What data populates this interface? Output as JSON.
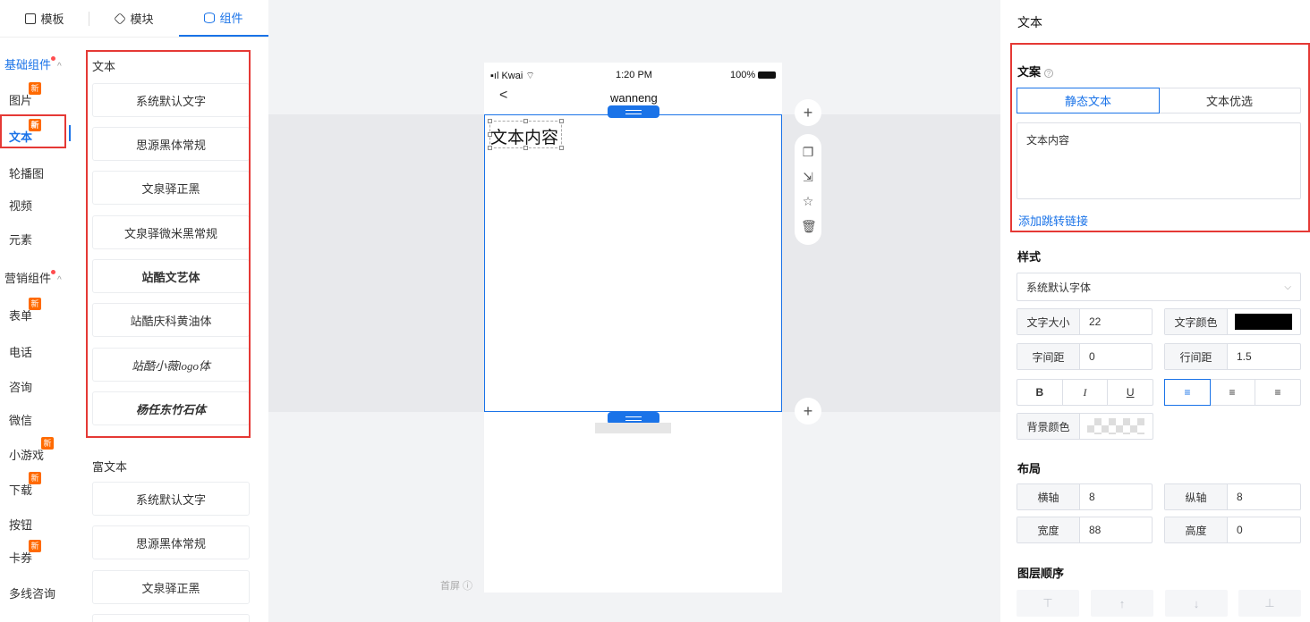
{
  "tabs": [
    {
      "label": "模板",
      "icon": "template-icon"
    },
    {
      "label": "模块",
      "icon": "module-icon"
    },
    {
      "label": "组件",
      "icon": "component-icon"
    }
  ],
  "categories": {
    "basic_group": "基础组件",
    "marketing_group": "营销组件",
    "items": [
      "图片",
      "文本",
      "轮播图",
      "视频",
      "元素",
      "表单",
      "电话",
      "咨询",
      "微信",
      "小游戏",
      "下载",
      "按钮",
      "卡券",
      "多线咨询"
    ],
    "new_badge": "新"
  },
  "components": {
    "text_section": "文本",
    "text_fonts": [
      "系统默认文字",
      "思源黑体常规",
      "文泉驿正黑",
      "文泉驿微米黑常规",
      "站酷文艺体",
      "站酷庆科黄油体",
      "站酷小薇logo体",
      "杨任东竹石体"
    ],
    "rich_section": "富文本",
    "rich_fonts": [
      "系统默认文字",
      "思源黑体常规",
      "文泉驿正黑"
    ]
  },
  "phone": {
    "carrier": "Kwai",
    "time": "1:20 PM",
    "battery": "100%",
    "back": "<",
    "title": "wanneng",
    "text_content": "文本内容",
    "first_screen": "首屏"
  },
  "properties": {
    "title": "文本",
    "copy_label": "文案",
    "copy_modes": [
      "静态文本",
      "文本优选"
    ],
    "copy_value": "文本内容",
    "add_link": "添加跳转链接",
    "style_label": "样式",
    "font_select": "系统默认字体",
    "font_size_label": "文字大小",
    "font_size": "22",
    "font_color_label": "文字颜色",
    "font_color": "#000000",
    "letter_spacing_label": "字间距",
    "letter_spacing": "0",
    "line_height_label": "行间距",
    "line_height": "1.5",
    "format": [
      "B",
      "I",
      "U"
    ],
    "align": [
      "≡",
      "≡",
      "≡"
    ],
    "bg_color_label": "背景颜色",
    "layout_label": "布局",
    "x_label": "横轴",
    "x": "8",
    "y_label": "纵轴",
    "y": "8",
    "width_label": "宽度",
    "width": "88",
    "height_label": "高度",
    "height": "0",
    "layer_label": "图层顺序",
    "layer_btns": [
      "⊤",
      "↑",
      "↓",
      "⊥"
    ]
  },
  "colors": {
    "accent": "#1a73e8",
    "highlight": "#e53935",
    "badge": "#ff6a00"
  }
}
